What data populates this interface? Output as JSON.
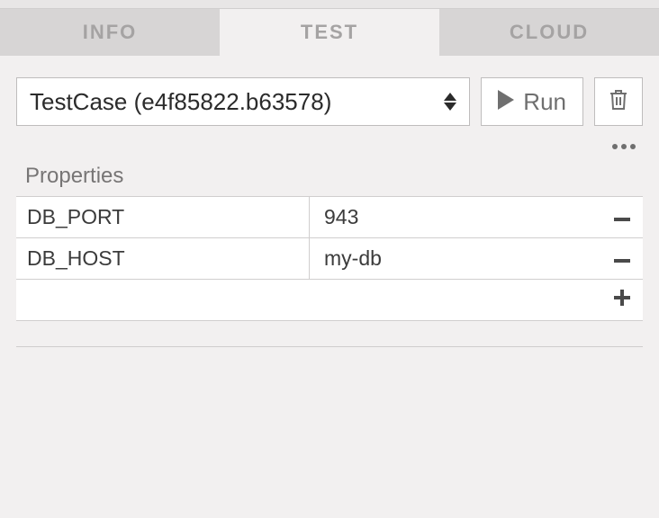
{
  "tabs": {
    "info": "INFO",
    "test": "TEST",
    "cloud": "CLOUD",
    "active": "test"
  },
  "testSelect": {
    "label": "TestCase (e4f85822.b63578)"
  },
  "toolbar": {
    "run_label": "Run"
  },
  "propertiesSection": {
    "title": "Properties"
  },
  "properties": [
    {
      "key": "DB_PORT",
      "value": "943"
    },
    {
      "key": "DB_HOST",
      "value": "my-db"
    }
  ]
}
